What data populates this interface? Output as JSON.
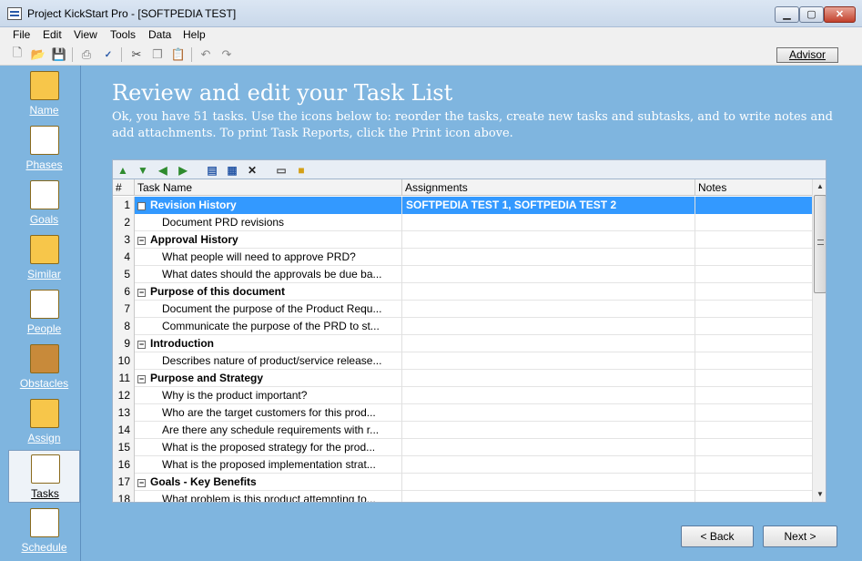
{
  "window": {
    "title": "Project KickStart Pro - [SOFTPEDIA TEST]"
  },
  "menu": [
    "File",
    "Edit",
    "View",
    "Tools",
    "Data",
    "Help"
  ],
  "toolbar": {
    "advisor_label": "Advisor"
  },
  "sidebar": {
    "items": [
      {
        "label": "Name",
        "icon": "name-pencil-icon"
      },
      {
        "label": "Phases",
        "icon": "phases-icon"
      },
      {
        "label": "Goals",
        "icon": "goals-chart-icon"
      },
      {
        "label": "Similar",
        "icon": "similar-folder-icon"
      },
      {
        "label": "People",
        "icon": "people-icon"
      },
      {
        "label": "Obstacles",
        "icon": "obstacles-fence-icon"
      },
      {
        "label": "Assign",
        "icon": "assign-icon"
      },
      {
        "label": "Tasks",
        "icon": "tasks-clipboard-icon"
      },
      {
        "label": "Schedule",
        "icon": "schedule-calendar-icon"
      }
    ],
    "active": "Tasks"
  },
  "main": {
    "title": "Review and edit your Task List",
    "description": "Ok, you have 51 tasks. Use the icons below to: reorder the tasks, create new tasks and subtasks, and to write notes and add attachments. To print Task Reports, click the Print icon above."
  },
  "grid": {
    "columns": [
      "#",
      "Task Name",
      "Assignments",
      "Notes"
    ],
    "rows": [
      {
        "n": "1",
        "task": "Revision History",
        "assign": "SOFTPEDIA TEST 1, SOFTPEDIA TEST 2",
        "group": true,
        "selected": true
      },
      {
        "n": "2",
        "task": "Document PRD revisions",
        "assign": "",
        "group": false
      },
      {
        "n": "3",
        "task": "Approval History",
        "assign": "",
        "group": true
      },
      {
        "n": "4",
        "task": "What people will need to approve PRD?",
        "assign": "",
        "group": false
      },
      {
        "n": "5",
        "task": "What dates should the approvals be due ba...",
        "assign": "",
        "group": false
      },
      {
        "n": "6",
        "task": "Purpose of this document",
        "assign": "",
        "group": true
      },
      {
        "n": "7",
        "task": "Document the purpose of the Product Requ...",
        "assign": "",
        "group": false
      },
      {
        "n": "8",
        "task": "Communicate the purpose of the PRD to st...",
        "assign": "",
        "group": false
      },
      {
        "n": "9",
        "task": "Introduction",
        "assign": "",
        "group": true
      },
      {
        "n": "10",
        "task": "Describes nature of product/service release...",
        "assign": "",
        "group": false
      },
      {
        "n": "11",
        "task": "Purpose and Strategy",
        "assign": "",
        "group": true
      },
      {
        "n": "12",
        "task": "Why is the product important?",
        "assign": "",
        "group": false
      },
      {
        "n": "13",
        "task": "Who are the target customers for this prod...",
        "assign": "",
        "group": false
      },
      {
        "n": "14",
        "task": "Are there any schedule requirements with r...",
        "assign": "",
        "group": false
      },
      {
        "n": "15",
        "task": "What is the proposed strategy for the prod...",
        "assign": "",
        "group": false
      },
      {
        "n": "16",
        "task": "What is the proposed implementation strat...",
        "assign": "",
        "group": false
      },
      {
        "n": "17",
        "task": "Goals - Key Benefits",
        "assign": "",
        "group": true
      },
      {
        "n": "18",
        "task": "What problem is this product attempting to...",
        "assign": "",
        "group": false
      }
    ]
  },
  "nav": {
    "back": "< Back",
    "next": "Next >"
  }
}
